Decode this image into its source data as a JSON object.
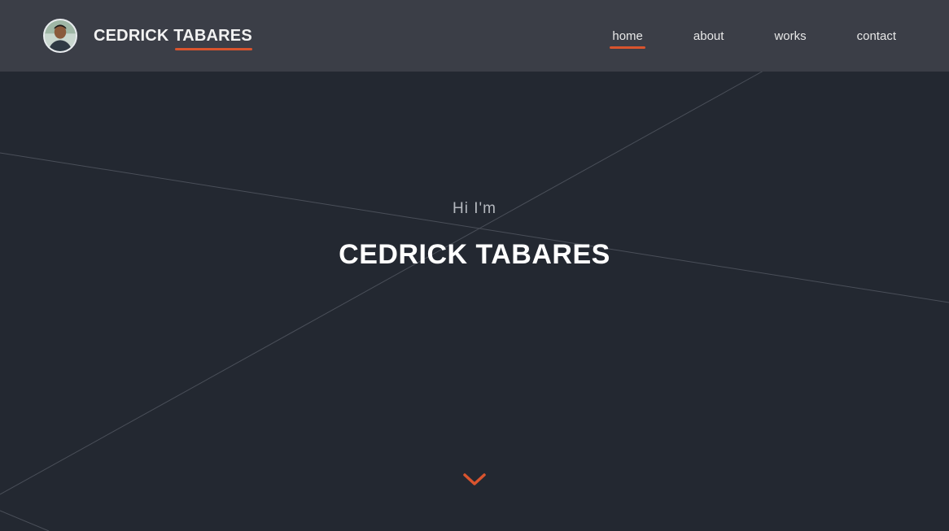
{
  "header": {
    "brand_name": "CEDRICK TABARES",
    "nav": [
      {
        "label": "home",
        "active": true
      },
      {
        "label": "about",
        "active": false
      },
      {
        "label": "works",
        "active": false
      },
      {
        "label": "contact",
        "active": false
      }
    ]
  },
  "hero": {
    "greeting": "Hi I'm",
    "name": "CEDRICK TABARES"
  },
  "icons": {
    "avatar": "profile-photo",
    "scroll": "chevron-down-icon"
  },
  "colors": {
    "background": "#232831",
    "navbar": "#3b3e47",
    "accent": "#d9542e",
    "text_primary": "#ffffff",
    "text_muted": "#b4b8be"
  }
}
